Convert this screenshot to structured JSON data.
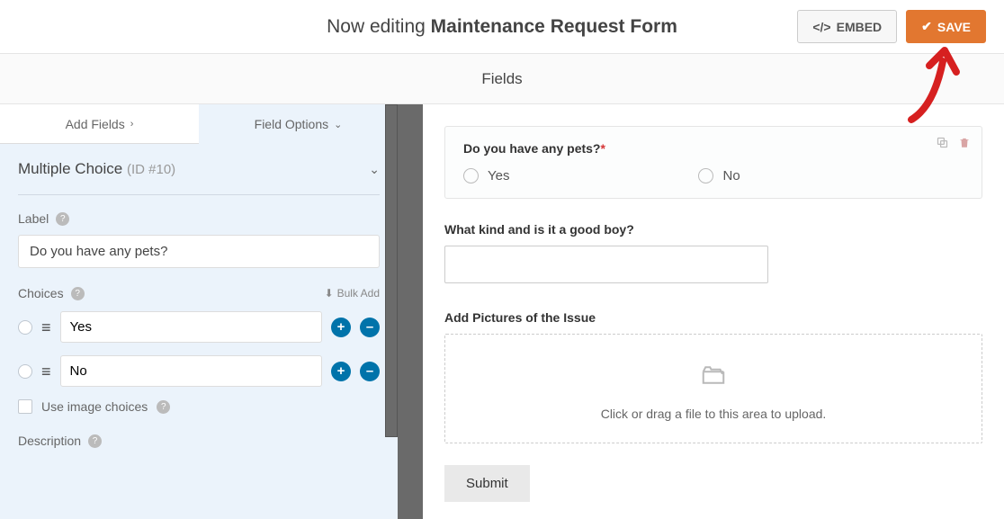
{
  "topbar": {
    "editing_prefix": "Now editing ",
    "form_name": "Maintenance Request Form",
    "embed_label": "EMBED",
    "save_label": "SAVE"
  },
  "subheader": "Fields",
  "sidebar": {
    "tab_add": "Add Fields",
    "tab_options": "Field Options",
    "field_type": "Multiple Choice",
    "field_id": "(ID #10)",
    "label_heading": "Label",
    "label_value": "Do you have any pets?",
    "choices_heading": "Choices",
    "bulk_add": "Bulk Add",
    "choices": [
      "Yes",
      "No"
    ],
    "image_choices_label": "Use image choices",
    "description_heading": "Description"
  },
  "preview": {
    "q1_label": "Do you have any pets?",
    "q1_opts": [
      "Yes",
      "No"
    ],
    "q2_label": "What kind and is it a good boy?",
    "q3_label": "Add Pictures of the Issue",
    "upload_text": "Click or drag a file to this area to upload.",
    "submit": "Submit"
  }
}
